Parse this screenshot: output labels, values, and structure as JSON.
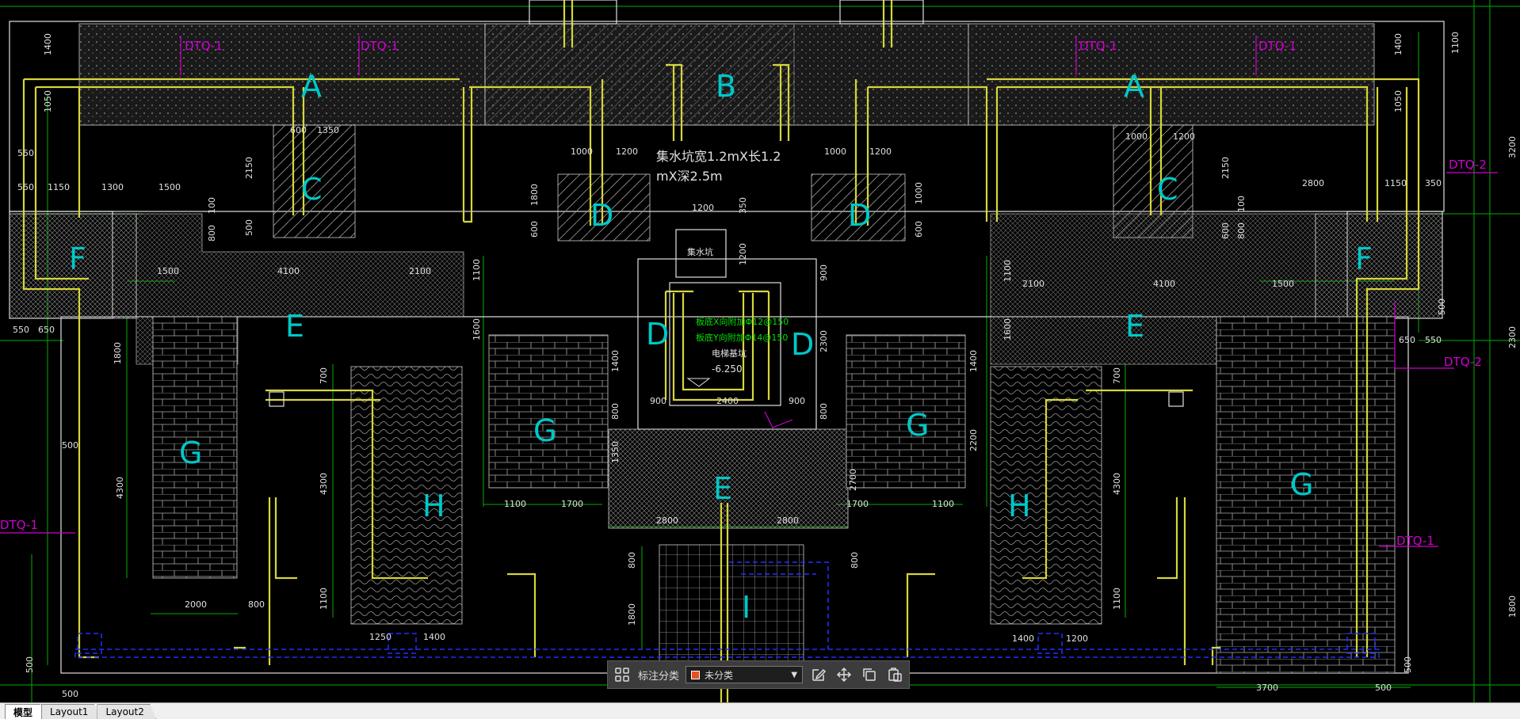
{
  "app": {
    "title": "CAD floor plan"
  },
  "regions": {
    "A_left": "A",
    "B": "B",
    "A_right": "A",
    "C_left": "C",
    "C_right": "C",
    "D_left": "D",
    "D_right": "D",
    "D_lift_left": "D",
    "D_lift_right": "D",
    "E_left": "E",
    "E_right": "E",
    "E_center": "E",
    "F_left": "F",
    "F_right": "F",
    "G_1": "G",
    "G_2": "G",
    "G_3": "G",
    "G_4": "G",
    "H_left": "H",
    "H_right": "H",
    "I": "I"
  },
  "tags": {
    "dtq1": "DTQ-1",
    "dtq2": "DTQ-2"
  },
  "notes": {
    "sump_line1": "集水坑宽1.2mX长1.2",
    "sump_line2": "mX深2.5m",
    "sump_box": "集水坑",
    "rebar1": "板底X向附加Φ12@150",
    "rebar2": "板底Y向附加Φ14@150",
    "lift_pit": "电梯基坑",
    "elevation": "-6.250"
  },
  "dims": {
    "d1400": "1400",
    "d1050": "1050",
    "d1100": "1100",
    "d1350": "1350",
    "d600": "600",
    "d1000": "1000",
    "d1200": "1200",
    "d550": "550",
    "d1150": "1150",
    "d1300": "1300",
    "d1500": "1500",
    "d2150": "2150",
    "d800": "800",
    "d500": "500",
    "d4100": "4100",
    "d2100": "2100",
    "d1800": "1800",
    "d650": "650",
    "d4300": "4300",
    "d2000": "2000",
    "d1250": "1250",
    "d1600": "1600",
    "d900": "900",
    "d2400": "2400",
    "d2300": "2300",
    "d700": "700",
    "d1700": "1700",
    "d2800": "2800",
    "d2200": "2200",
    "d2700": "2700",
    "d3700": "3700",
    "d3200": "3200",
    "d350": "350",
    "d100": "100",
    "d280O": "2800"
  },
  "toolbar": {
    "label": "标注分类",
    "selected": "未分类",
    "swatch_color": "#e8501e"
  },
  "tabs": [
    "模型",
    "Layout1",
    "Layout2"
  ],
  "colors": {
    "background": "#000000",
    "wall": "#d6d63a",
    "dim": "#00e000",
    "tag": "#d000d0",
    "region": "#00c8c8",
    "outline": "#ffffff",
    "blue": "#2030ff"
  }
}
